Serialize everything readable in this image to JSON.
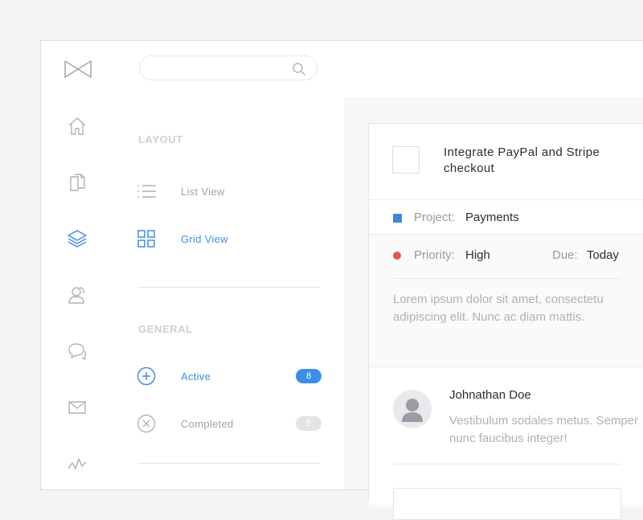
{
  "search": {
    "value": "",
    "placeholder": ""
  },
  "rail": {
    "items": [
      {
        "icon": "home-icon"
      },
      {
        "icon": "documents-icon"
      },
      {
        "icon": "layers-icon",
        "active": true
      },
      {
        "icon": "contacts-icon"
      },
      {
        "icon": "chat-icon"
      },
      {
        "icon": "mail-icon"
      },
      {
        "icon": "activity-icon"
      }
    ]
  },
  "panel": {
    "layout_title": "LAYOUT",
    "list_view": "List View",
    "grid_view": "Grid View",
    "general_title": "GENERAL",
    "active": {
      "label": "Active",
      "count": "8"
    },
    "completed": {
      "label": "Completed",
      "count": "5"
    }
  },
  "task": {
    "title": "Integrate PayPal and Stripe checkout",
    "project_label": "Project:",
    "project_value": "Payments",
    "priority_label": "Priority:",
    "priority_value": "High",
    "due_label": "Due:",
    "due_value": "Today",
    "description": "Lorem ipsum dolor sit amet, consectetu adipiscing elit. Nunc ac diam mattis."
  },
  "comment": {
    "author": "Johnathan Doe",
    "text": "Vestibulum sodales metus. Semper nunc faucibus integer!"
  },
  "colors": {
    "accent": "#3d8ee6",
    "project_square": "#3d86d9",
    "priority_dot": "#e2574c"
  }
}
